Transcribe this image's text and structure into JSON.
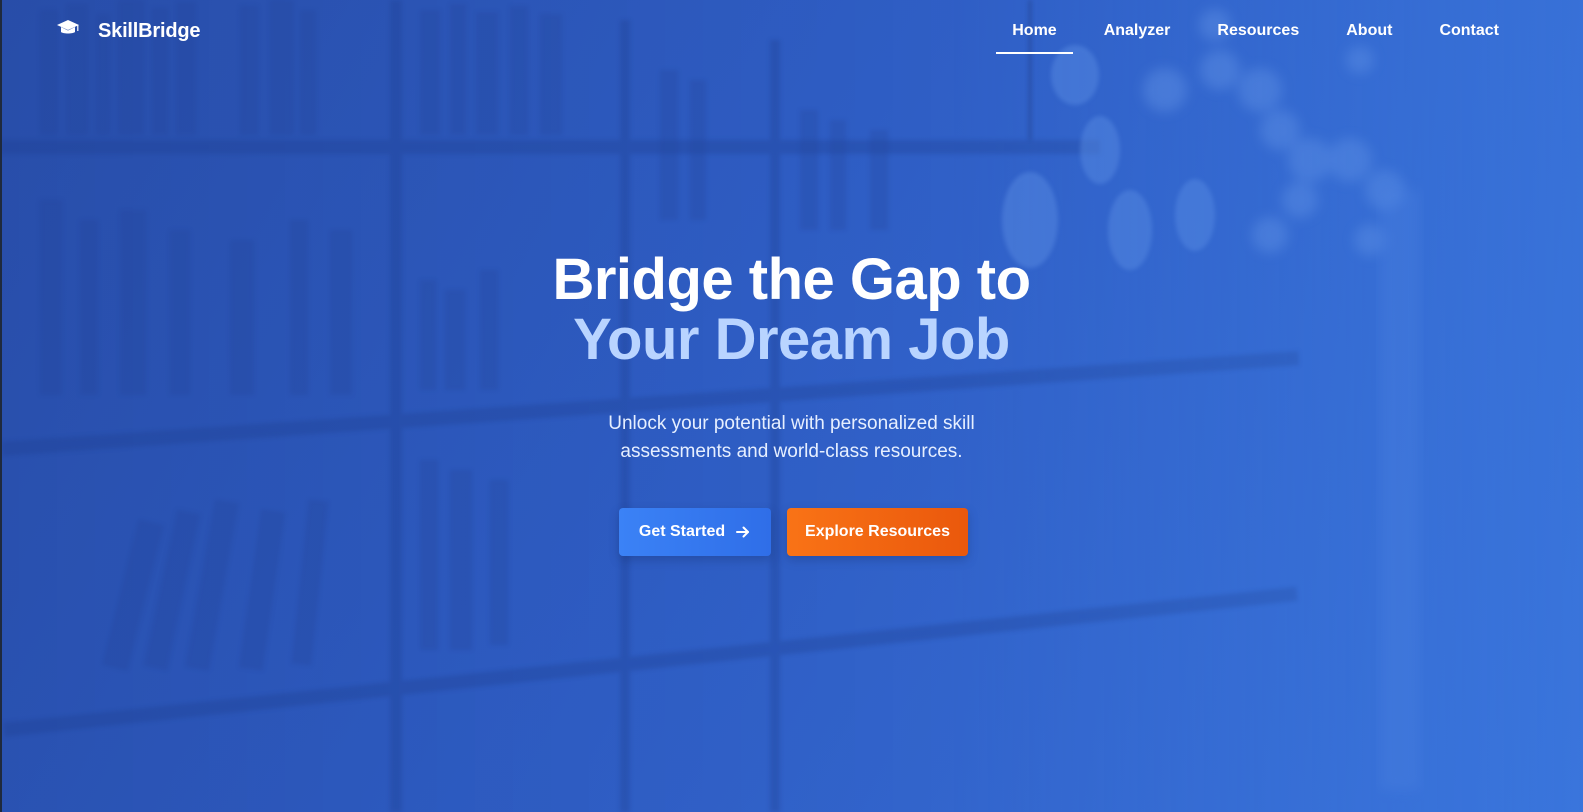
{
  "brand": {
    "name": "SkillBridge",
    "icon": "graduation-cap-icon"
  },
  "nav": {
    "items": [
      {
        "label": "Home",
        "active": true
      },
      {
        "label": "Analyzer",
        "active": false
      },
      {
        "label": "Resources",
        "active": false
      },
      {
        "label": "About",
        "active": false
      },
      {
        "label": "Contact",
        "active": false
      }
    ]
  },
  "hero": {
    "title_line1": "Bridge the Gap to",
    "title_line2": "Your Dream Job",
    "subtitle": "Unlock your potential with personalized skill assessments and world-class resources.",
    "primary_button": {
      "label": "Get Started",
      "icon": "arrow-right-icon"
    },
    "secondary_button": {
      "label": "Explore Resources"
    }
  },
  "colors": {
    "background": "#2f5ec4",
    "title_accent": "#b9d4ff",
    "primary_button": "#3b82f6",
    "secondary_button": "#f97316"
  }
}
